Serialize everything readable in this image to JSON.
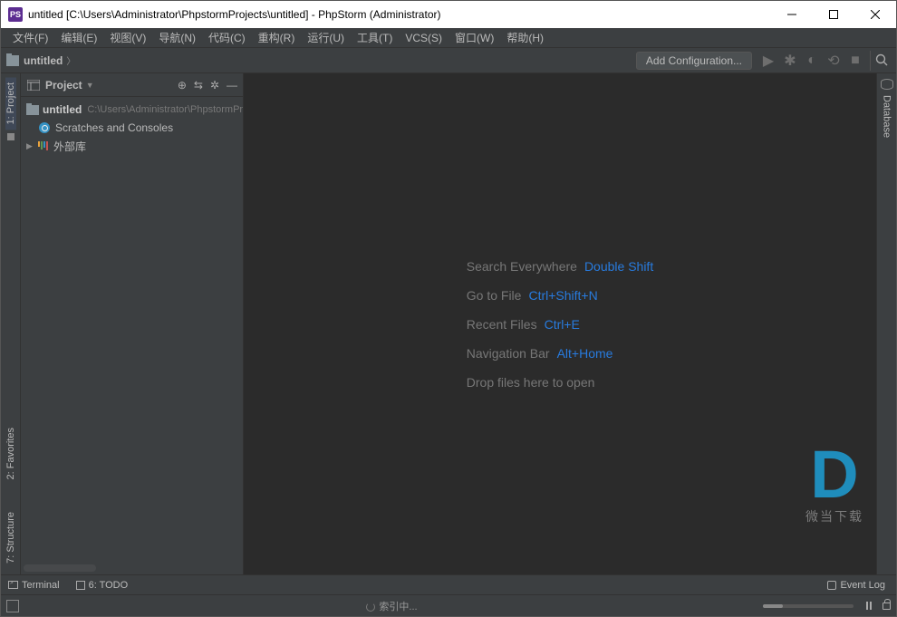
{
  "window": {
    "title": "untitled [C:\\Users\\Administrator\\PhpstormProjects\\untitled] - PhpStorm (Administrator)",
    "app_badge": "PS"
  },
  "menu": {
    "file": "文件(F)",
    "edit": "编辑(E)",
    "view": "视图(V)",
    "navigate": "导航(N)",
    "code": "代码(C)",
    "refactor": "重构(R)",
    "run": "运行(U)",
    "tools": "工具(T)",
    "vcs": "VCS(S)",
    "window": "窗口(W)",
    "help": "帮助(H)"
  },
  "nav": {
    "crumb": "untitled",
    "add_config": "Add Configuration..."
  },
  "left_stripe": {
    "project": "1: Project",
    "favorites": "2: Favorites",
    "structure": "7: Structure"
  },
  "right_stripe": {
    "database": "Database"
  },
  "project_panel": {
    "title": "Project",
    "root": {
      "name": "untitled",
      "path": "C:\\Users\\Administrator\\PhpstormProjects\\untitled"
    },
    "scratches": "Scratches and Consoles",
    "external": "外部库"
  },
  "hints": {
    "search": {
      "label": "Search Everywhere",
      "key": "Double Shift"
    },
    "gotofile": {
      "label": "Go to File",
      "key": "Ctrl+Shift+N"
    },
    "recent": {
      "label": "Recent Files",
      "key": "Ctrl+E"
    },
    "navbar": {
      "label": "Navigation Bar",
      "key": "Alt+Home"
    },
    "drop": "Drop files here to open"
  },
  "bottom": {
    "terminal": "Terminal",
    "todo": "6: TODO",
    "eventlog": "Event Log"
  },
  "status": {
    "indexing": "索引中..."
  },
  "watermark": {
    "logo": "D",
    "text": "微当下载"
  }
}
